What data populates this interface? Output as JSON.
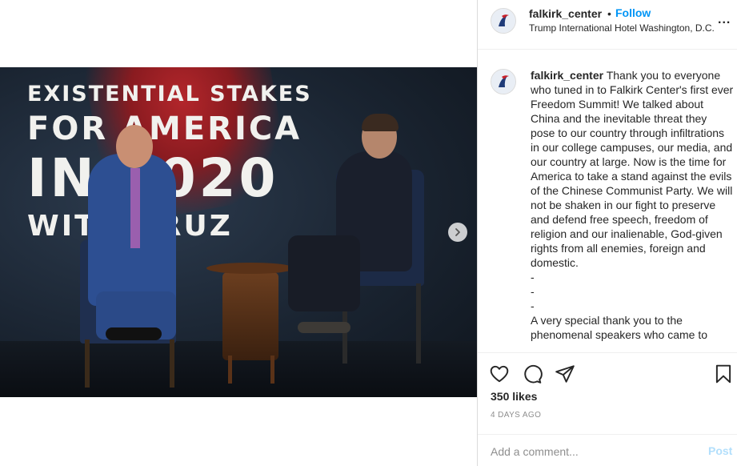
{
  "post": {
    "media": {
      "banner_lines": [
        "EXISTENTIAL STAKES",
        "FOR AMERICA",
        "IN 2020",
        "WITH CRUZ"
      ],
      "next_icon": "chevron-right-icon"
    },
    "header": {
      "username": "falkirk_center",
      "separator": "•",
      "follow_label": "Follow",
      "location": "Trump International Hotel Washington, D.C.",
      "more_label": "..."
    },
    "caption": {
      "username": "falkirk_center",
      "text": " Thank you to everyone who tuned in to Falkirk Center's first ever Freedom Summit! We talked about China and the inevitable threat they pose to our country through infiltrations in our college campuses, our media, and our country at large. Now is the time for America to take a stand against the evils of the Chinese Communist Party. We will not be shaken in our fight to preserve and defend free speech, freedom of religion and our inalienable, God-given rights from all enemies, foreign and domestic.\n-\n-\n-\nA very special thank you to the phenomenal speakers who came to"
    },
    "actions": {
      "like_icon": "heart-icon",
      "comment_icon": "comment-icon",
      "share_icon": "paper-plane-icon",
      "save_icon": "bookmark-icon",
      "likes": "350 likes",
      "time_ago": "4 DAYS AGO"
    },
    "comment": {
      "placeholder": "Add a comment...",
      "post_label": "Post"
    },
    "colors": {
      "accent": "#0095f6",
      "post_disabled": "#b2dffc",
      "muted": "#8e8e8e",
      "border": "#dbdbdb"
    }
  }
}
